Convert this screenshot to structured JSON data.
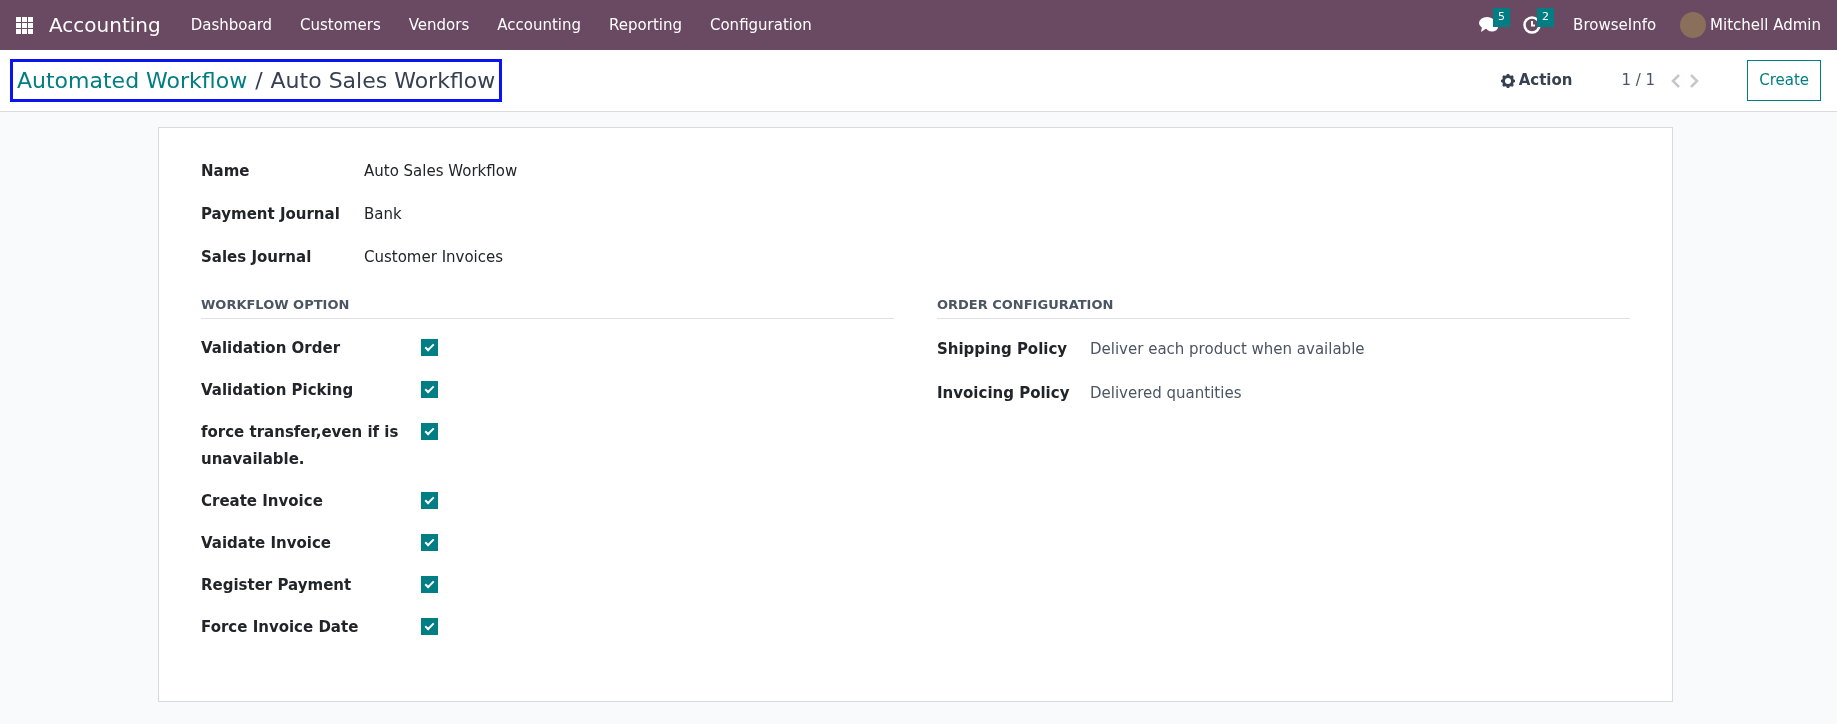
{
  "navbar": {
    "app_name": "Accounting",
    "menu": [
      {
        "label": "Dashboard"
      },
      {
        "label": "Customers"
      },
      {
        "label": "Vendors"
      },
      {
        "label": "Accounting"
      },
      {
        "label": "Reporting"
      },
      {
        "label": "Configuration"
      }
    ],
    "messages_count": "5",
    "activities_count": "2",
    "company": "BrowseInfo",
    "user": "Mitchell Admin"
  },
  "control_panel": {
    "breadcrumb": {
      "parent": "Automated Workflow",
      "separator": "/",
      "current": "Auto Sales Workflow"
    },
    "action": "Action",
    "pager": "1 / 1",
    "create": "Create"
  },
  "form": {
    "fields": [
      {
        "label": "Name",
        "value": "Auto Sales Workflow"
      },
      {
        "label": "Payment Journal",
        "value": "Bank"
      },
      {
        "label": "Sales Journal",
        "value": "Customer Invoices"
      }
    ],
    "workflow_option": {
      "title": "WORKFLOW OPTION",
      "options": [
        {
          "label": "Validation Order",
          "checked": true
        },
        {
          "label": "Validation Picking",
          "checked": true
        },
        {
          "label": "force transfer,even if is unavailable.",
          "checked": true
        },
        {
          "label": "Create Invoice",
          "checked": true
        },
        {
          "label": "Vaidate Invoice",
          "checked": true
        },
        {
          "label": "Register Payment",
          "checked": true
        },
        {
          "label": "Force Invoice Date",
          "checked": true
        }
      ]
    },
    "order_configuration": {
      "title": "ORDER CONFIGURATION",
      "fields": [
        {
          "label": "Shipping Policy",
          "value": "Deliver each product when available"
        },
        {
          "label": "Invoicing Policy",
          "value": "Delivered quantities"
        }
      ]
    }
  }
}
